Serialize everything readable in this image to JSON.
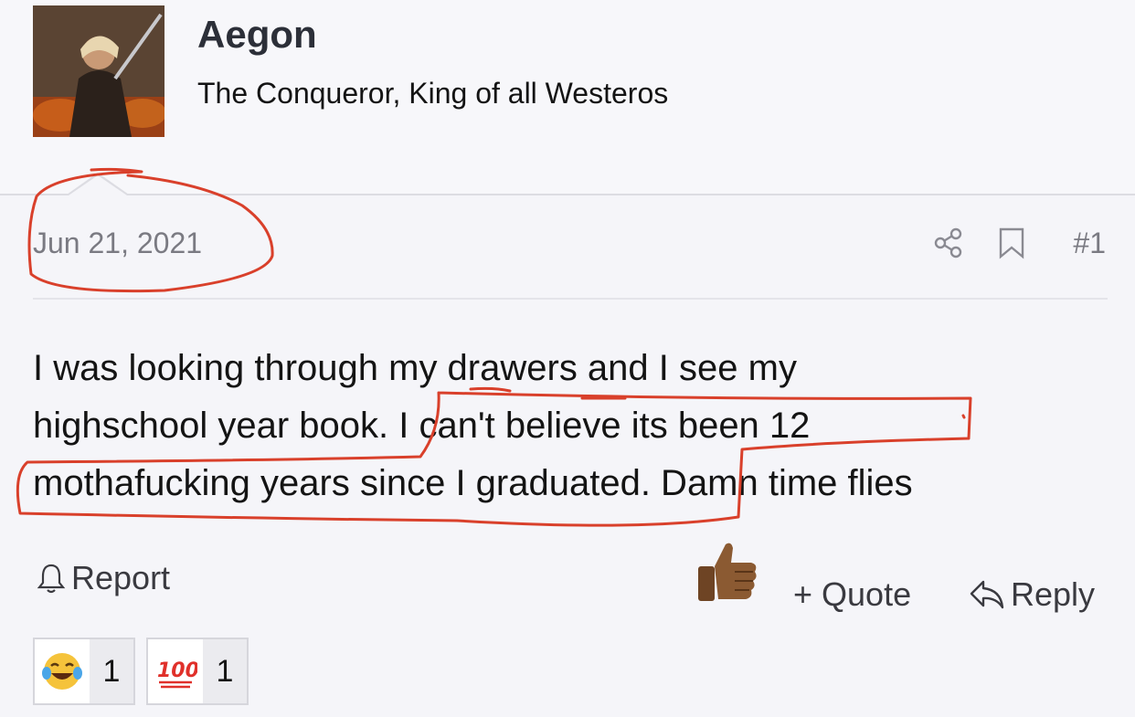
{
  "user": {
    "name": "Aegon",
    "title": "The Conqueror, King of all Westeros",
    "avatar_icon": "user-avatar-knight"
  },
  "post": {
    "date": "Jun 21, 2021",
    "number": "#1",
    "body": "I was looking through my drawers and I see my highschool year book. I can't believe its been 12 mothafucking years since I graduated. Damn time flies",
    "body_lines": [
      "I was looking through my drawers and I see my",
      "highschool year book. I can't believe its been 12",
      "mothafucking years since I graduated. Damn time flies"
    ]
  },
  "actions": {
    "share_icon": "share-icon",
    "bookmark_icon": "bookmark-icon",
    "report_label": "Report",
    "quote_label": "+ Quote",
    "reply_label": "Reply"
  },
  "reactions": [
    {
      "emoji": "😂",
      "icon": "tears-of-joy-emoji",
      "count": "1"
    },
    {
      "emoji": "💯",
      "icon": "hundred-points-emoji",
      "count": "1"
    }
  ],
  "overlay": {
    "thumbs_up": "👍🏾",
    "annotation_color": "#d9402b"
  }
}
